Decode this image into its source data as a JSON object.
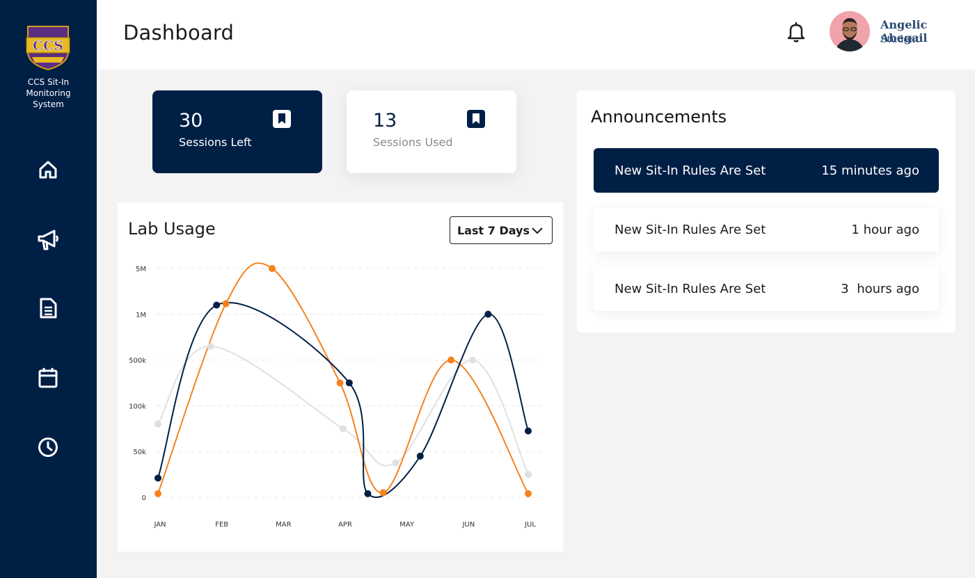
{
  "sidebar": {
    "system_name": "CCS Sit-In Monitoring System",
    "logo_text": "CCS",
    "nav_icons": [
      "home-icon",
      "megaphone-icon",
      "document-icon",
      "calendar-icon",
      "clock-icon"
    ]
  },
  "header": {
    "title": "Dashboard",
    "user_name": "Angelic Abegail",
    "user_role": "Student"
  },
  "stats": [
    {
      "value": "30",
      "label": "Sessions Left"
    },
    {
      "value": "13",
      "label": "Sessions Used"
    }
  ],
  "lab_usage": {
    "title": "Lab Usage",
    "range_selected": "Last 7 Days"
  },
  "chart_data": {
    "type": "line",
    "categories": [
      "JAN",
      "FEB",
      "MAR",
      "APR",
      "MAY",
      "JUN",
      "JUL"
    ],
    "y_ticks": [
      "5M",
      "1M",
      "500k",
      "100k",
      "50k",
      "0"
    ],
    "grid": true,
    "series": [
      {
        "color": "#001f45",
        "points": [
          [
            0,
            0.42
          ],
          [
            0.95,
            4.2
          ],
          [
            3.1,
            2.5
          ],
          [
            3.4,
            0.08
          ],
          [
            4.25,
            0.9
          ],
          [
            5.35,
            4.0
          ],
          [
            6.0,
            1.45
          ]
        ]
      },
      {
        "color": "#f5821f",
        "points": [
          [
            0,
            0.08
          ],
          [
            1.1,
            4.23
          ],
          [
            1.85,
            5.0
          ],
          [
            2.95,
            2.5
          ],
          [
            3.65,
            0.1
          ],
          [
            4.75,
            3.0
          ],
          [
            6.0,
            0.08
          ]
        ]
      },
      {
        "color": "#e0e0e0",
        "points": [
          [
            0,
            1.6
          ],
          [
            0.85,
            3.3
          ],
          [
            3.0,
            1.5
          ],
          [
            3.85,
            0.75
          ],
          [
            5.1,
            3.0
          ],
          [
            6.0,
            0.5
          ]
        ]
      }
    ]
  },
  "announcements": {
    "title": "Announcements",
    "items": [
      {
        "title": "New Sit-In Rules Are Set",
        "time": "15 minutes ago"
      },
      {
        "title": "New Sit-In Rules Are Set",
        "time": "1 hour ago"
      },
      {
        "title": "New Sit-In Rules Are Set",
        "time": "3  hours ago"
      }
    ]
  }
}
